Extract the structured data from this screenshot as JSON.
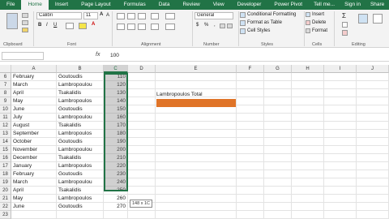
{
  "tabs": [
    "File",
    "Home",
    "Insert",
    "Page Layout",
    "Formulas",
    "Data",
    "Review",
    "View",
    "Developer",
    "Power Pivot"
  ],
  "tab_right": {
    "tell_me": "Tell me...",
    "sign_in": "Sign in",
    "share": "Share"
  },
  "ribbon": {
    "font_name": "Calibri",
    "font_size": "11",
    "number_format": "General",
    "conditional_formatting": "Conditional Formatting",
    "format_as_table": "Format as Table",
    "cell_styles": "Cell Styles",
    "insert": "Insert",
    "delete": "Delete",
    "format": "Format",
    "groups": {
      "clipboard": "Clipboard",
      "font": "Font",
      "alignment": "Alignment",
      "number": "Number",
      "styles": "Styles",
      "cells": "Cells",
      "editing": "Editing"
    }
  },
  "formula_bar": {
    "fx": "fx",
    "value": "100"
  },
  "columns": [
    "A",
    "B",
    "C",
    "D",
    "E",
    "F",
    "G",
    "H",
    "I",
    "J"
  ],
  "row_numbers": [
    "6",
    "7",
    "8",
    "9",
    "10",
    "11",
    "12",
    "13",
    "14",
    "15",
    "16",
    "17",
    "18",
    "19",
    "20",
    "21",
    "22",
    "23"
  ],
  "rows": [
    [
      "February",
      "Goutoudis",
      "110"
    ],
    [
      "March",
      "Lambropoulou",
      "120"
    ],
    [
      "April",
      "Tsakalidis",
      "130"
    ],
    [
      "May",
      "Lambropoulos",
      "140"
    ],
    [
      "June",
      "Goutoudis",
      "150"
    ],
    [
      "July",
      "Lambropoulou",
      "160"
    ],
    [
      "August",
      "Tsakalidis",
      "170"
    ],
    [
      "September",
      "Lambropoulos",
      "180"
    ],
    [
      "October",
      "Goutoudis",
      "190"
    ],
    [
      "November",
      "Lambropoulou",
      "200"
    ],
    [
      "December",
      "Tsakalidis",
      "210"
    ],
    [
      "January",
      "Lambropoulos",
      "220"
    ],
    [
      "February",
      "Goutoudis",
      "230"
    ],
    [
      "March",
      "Lambropoulou",
      "240"
    ],
    [
      "April",
      "Tsakalidis",
      "250"
    ],
    [
      "May",
      "Lambropoulos",
      "260"
    ],
    [
      "June",
      "Goutoudis",
      "270"
    ],
    [
      "",
      "",
      ""
    ]
  ],
  "e_label": "Lambropoulos Total",
  "tooltip": "148 x 1C",
  "colors": {
    "excel_green": "#217346",
    "orange_fill": "#e07428"
  }
}
